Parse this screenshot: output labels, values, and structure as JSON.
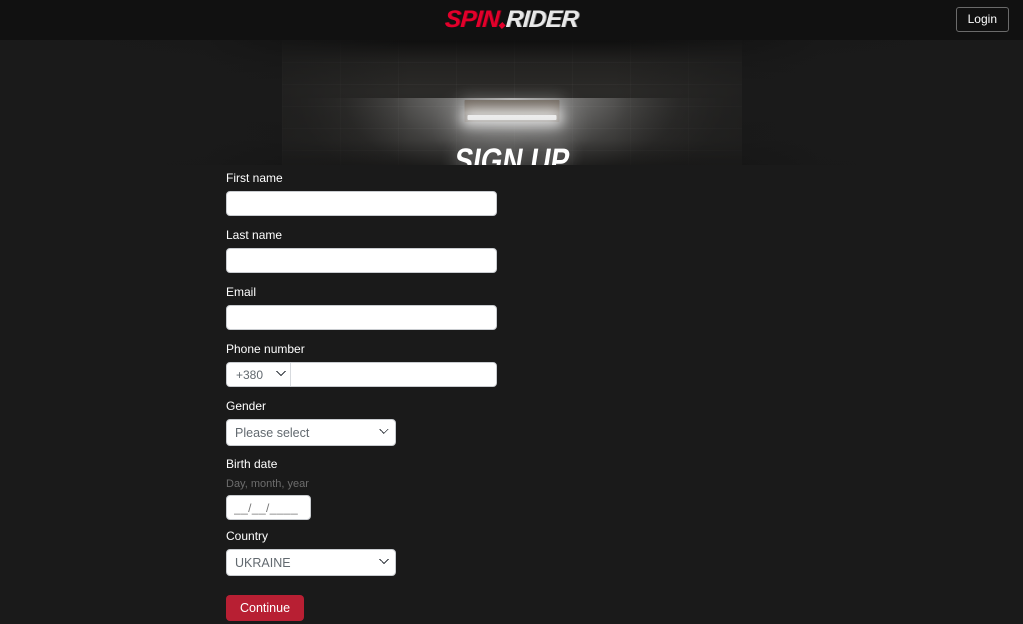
{
  "header": {
    "logo": {
      "part1": "SPIN",
      "separator_icon": "diamond-dot-icon",
      "part2": "RIDER"
    },
    "login_label": "Login"
  },
  "hero": {
    "title": "SIGN UP",
    "lamp_icon": "fluorescent-lamp-icon"
  },
  "form": {
    "first_name": {
      "label": "First name",
      "value": "",
      "placeholder": ""
    },
    "last_name": {
      "label": "Last name",
      "value": "",
      "placeholder": ""
    },
    "email": {
      "label": "Email",
      "value": "",
      "placeholder": ""
    },
    "phone": {
      "label": "Phone number",
      "country_code": "+380",
      "value": "",
      "placeholder": ""
    },
    "gender": {
      "label": "Gender",
      "value": "Please select"
    },
    "birth_date": {
      "label": "Birth date",
      "hint": "Day, month, year",
      "value": "",
      "placeholder": "__/__/____"
    },
    "country": {
      "label": "Country",
      "value": "UKRAINE"
    },
    "submit_label": "Continue"
  },
  "colors": {
    "page_background": "#1a1a1a",
    "header_background": "#111111",
    "brand_red": "#e3002b",
    "accent_button": "#b81f33",
    "label_text": "#ffffff",
    "hint_text": "#6d6d6d"
  }
}
